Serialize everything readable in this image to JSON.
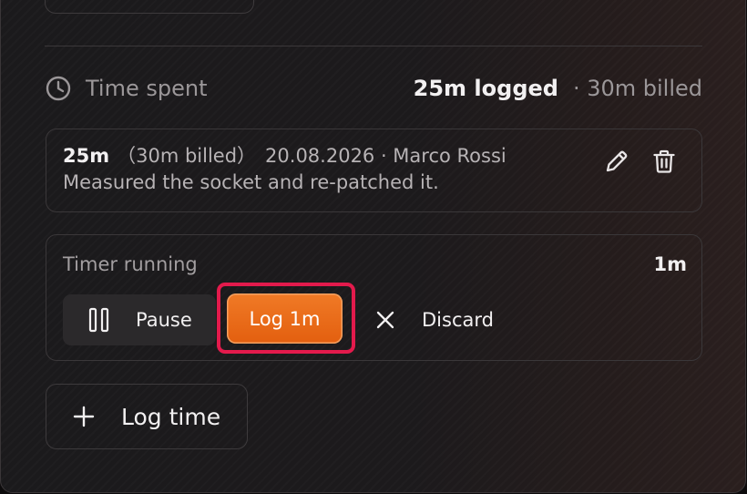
{
  "time_spent": {
    "icon": "clock-icon",
    "title": "Time spent",
    "logged": "25m logged",
    "billed": "· 30m billed"
  },
  "entry": {
    "duration": "25m",
    "billed": "（30m billed）",
    "date_author": "20.08.2026 · Marco Rossi",
    "note": "Measured the socket and re-patched it.",
    "edit_icon": "pencil-icon",
    "delete_icon": "trash-icon"
  },
  "timer": {
    "label": "Timer running",
    "value": "1m",
    "pause_label": "Pause",
    "log_label": "Log 1m",
    "discard_label": "Discard"
  },
  "actions": {
    "log_time_label": "Log time"
  },
  "colors": {
    "accent": "#e8681a",
    "highlight": "#e31a4c",
    "text_primary": "#f2f0f1",
    "text_muted": "#9b9799"
  }
}
